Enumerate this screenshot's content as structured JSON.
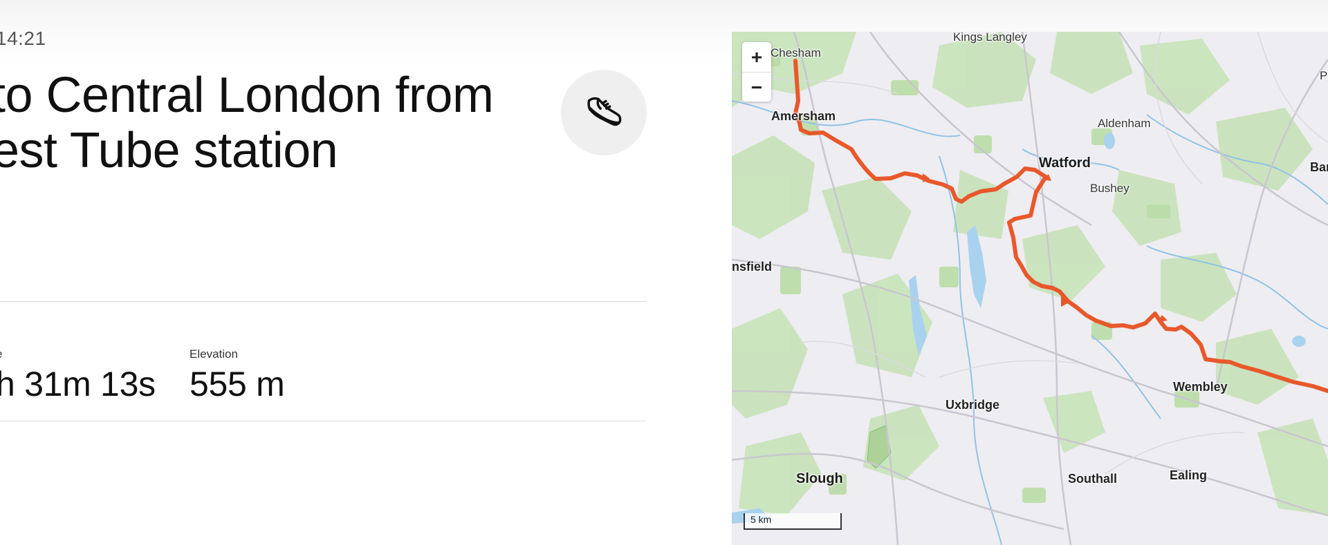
{
  "activity": {
    "time": "14:21",
    "title": "to Central London from\nest Tube station",
    "sport_icon": "running-shoe-icon"
  },
  "stats": [
    {
      "label": "e",
      "value": "h 31m 13s"
    },
    {
      "label": "Elevation",
      "value": "555 m"
    }
  ],
  "map": {
    "zoom_in_label": "+",
    "zoom_out_label": "−",
    "scale_label": "5 km",
    "route_color": "#e8582b",
    "places": [
      {
        "name": "Kings Langley",
        "class": "minor"
      },
      {
        "name": "Chesham",
        "class": "minor"
      },
      {
        "name": "Amersham",
        "class": "mid"
      },
      {
        "name": "Aldenham",
        "class": "minor"
      },
      {
        "name": "Watford",
        "class": "major"
      },
      {
        "name": "Bushey",
        "class": "minor"
      },
      {
        "name": "nsfield",
        "class": "mid"
      },
      {
        "name": "Wembley",
        "class": "mid"
      },
      {
        "name": "Uxbridge",
        "class": "mid"
      },
      {
        "name": "Slough",
        "class": "major"
      },
      {
        "name": "Southall",
        "class": "mid"
      },
      {
        "name": "Ealing",
        "class": "mid"
      },
      {
        "name": "P",
        "class": "minor"
      },
      {
        "name": "Bar",
        "class": "mid"
      }
    ]
  }
}
